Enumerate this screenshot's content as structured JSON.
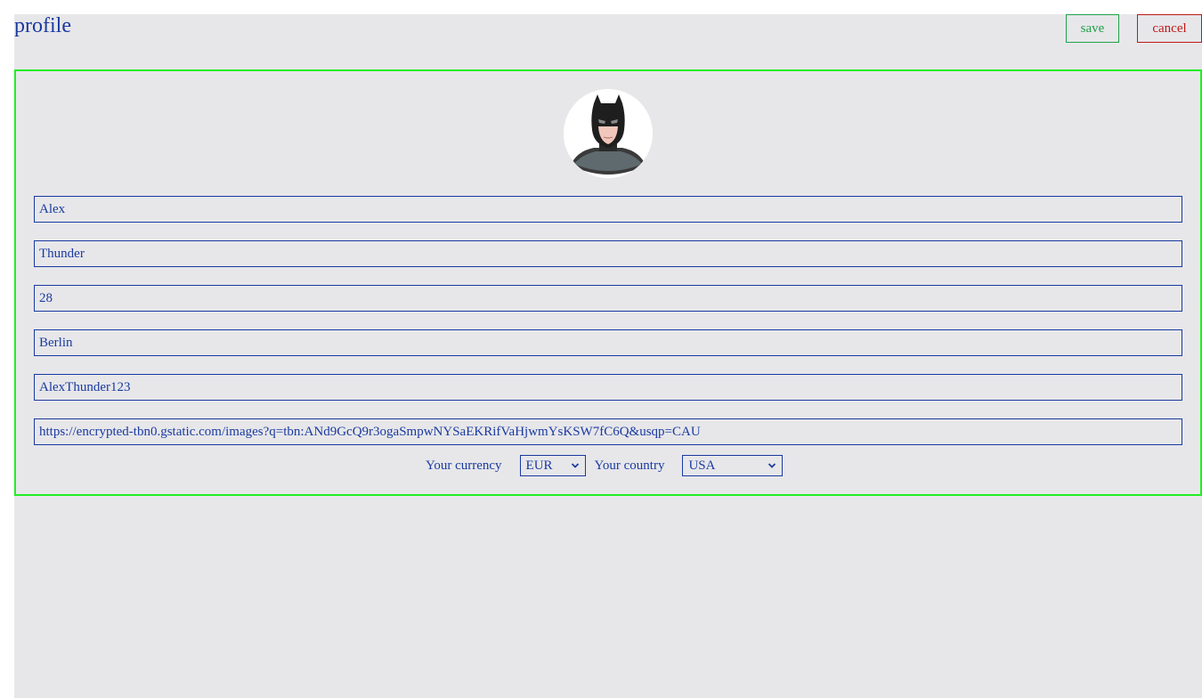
{
  "header": {
    "title": "profile",
    "save_label": "save",
    "cancel_label": "cancel"
  },
  "profile": {
    "avatar_alt": "batman-avatar-icon",
    "fields": {
      "first_name": "Alex",
      "last_name": "Thunder",
      "age": "28",
      "city": "Berlin",
      "username": "AlexThunder123",
      "image_url": "https://encrypted-tbn0.gstatic.com/images?q=tbn:ANd9GcQ9r3ogaSmpwNYSaEKRifVaHjwmYsKSW7fC6Q&usqp=CAU"
    },
    "currency_label": "Your currency",
    "currency_value": "EUR",
    "country_label": "Your country",
    "country_value": "USA"
  },
  "colors": {
    "background": "#e7e7ea",
    "text": "#1a3aa0",
    "save": "#22a04a",
    "cancel": "#c01818",
    "card_border": "#22ee22"
  }
}
